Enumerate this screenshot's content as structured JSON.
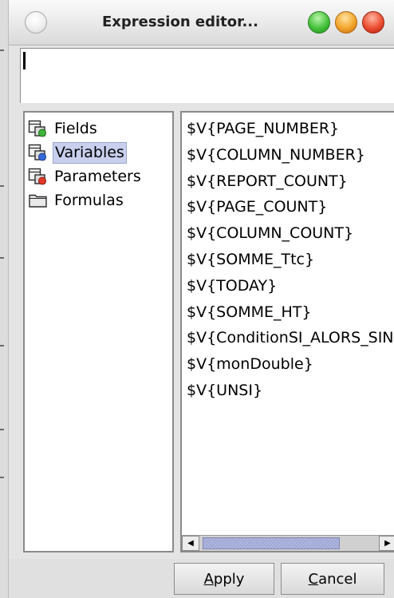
{
  "window": {
    "title": "Expression editor..."
  },
  "expression": {
    "value": ""
  },
  "categories": [
    {
      "label": "Fields",
      "icon": "fields-icon",
      "selected": false
    },
    {
      "label": "Variables",
      "icon": "variables-icon",
      "selected": true
    },
    {
      "label": "Parameters",
      "icon": "parameters-icon",
      "selected": false
    },
    {
      "label": "Formulas",
      "icon": "folder-icon",
      "selected": false
    }
  ],
  "variables": [
    "$V{PAGE_NUMBER}",
    "$V{COLUMN_NUMBER}",
    "$V{REPORT_COUNT}",
    "$V{PAGE_COUNT}",
    "$V{COLUMN_COUNT}",
    "$V{SOMME_Ttc}",
    "$V{TODAY}",
    "$V{SOMME_HT}",
    "$V{ConditionSI_ALORS_SINON}",
    "$V{monDouble}",
    "$V{UNSI}"
  ],
  "buttons": {
    "apply_mnemonic": "A",
    "apply_rest": "pply",
    "cancel_mnemonic": "C",
    "cancel_rest": "ancel"
  },
  "colors": {
    "selection": "#c9d0ee",
    "scroll_thumb": "#b3bbe0"
  }
}
